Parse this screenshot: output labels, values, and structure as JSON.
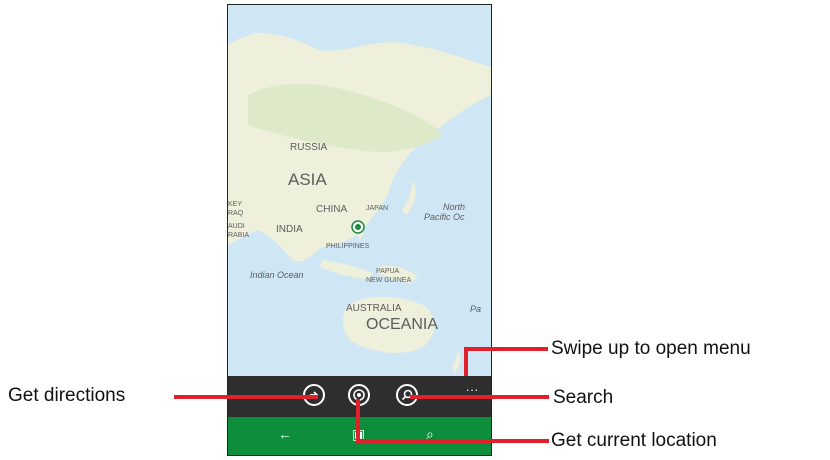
{
  "map": {
    "labels": {
      "russia": "RUSSIA",
      "asia": "ASIA",
      "china": "CHINA",
      "japan": "JAPAN",
      "india": "INDIA",
      "philippines": "PHILIPPINES",
      "papua1": "PAPUA",
      "papua2": "NEW GUINEA",
      "indian_ocean": "Indian Ocean",
      "north": "North",
      "pacific": "Pacific Oc",
      "pa": "Pa",
      "australia": "AUSTRALIA",
      "oceania": "OCEANIA",
      "left1": "KEY",
      "left2": "RAQ",
      "left3": "AUDI",
      "left4": "RABIA"
    },
    "colors": {
      "water": "#cfe6f4",
      "land": "#f1f0df",
      "green": "#dbe9c9",
      "pin": "#1a8a3c"
    }
  },
  "app_bar": {
    "buttons": [
      {
        "name": "directions-icon"
      },
      {
        "name": "current-location-icon"
      },
      {
        "name": "search-icon"
      }
    ],
    "more": "..."
  },
  "nav_bar": {
    "back": "←",
    "start": "▣",
    "search": "⌕"
  },
  "callouts": {
    "swipe": "Swipe up to open menu",
    "directions": "Get directions",
    "search": "Search",
    "location": "Get current location"
  },
  "colors": {
    "callout_line": "#e0202a"
  }
}
